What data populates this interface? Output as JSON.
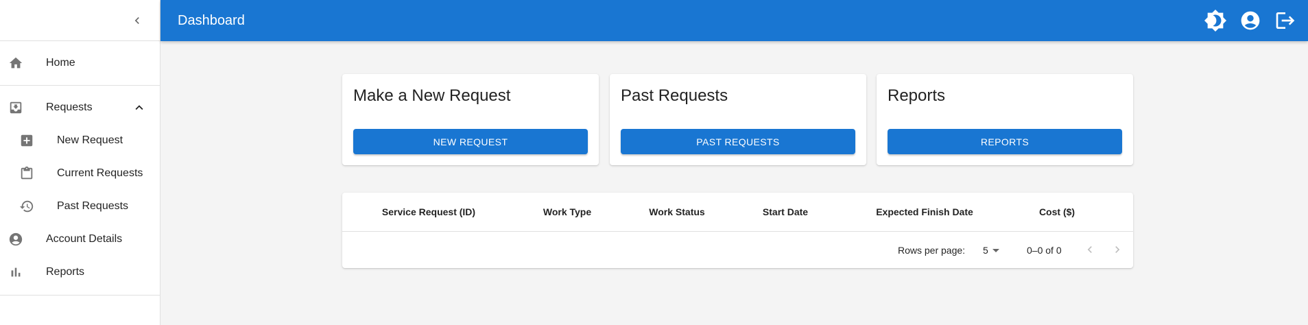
{
  "app_bar": {
    "title": "Dashboard",
    "actions": [
      {
        "icon": "brightness-icon",
        "name": "theme-toggle-button"
      },
      {
        "icon": "account-circle-icon",
        "name": "account-button"
      },
      {
        "icon": "logout-icon",
        "name": "logout-button"
      }
    ]
  },
  "sidebar": {
    "items": [
      {
        "label": "Home",
        "icon": "home-icon"
      },
      {
        "label": "Requests",
        "icon": "inbox-icon",
        "expanded": true
      },
      {
        "label": "New Request",
        "icon": "add-box-icon"
      },
      {
        "label": "Current Requests",
        "icon": "clipboard-icon"
      },
      {
        "label": "Past Requests",
        "icon": "history-icon"
      },
      {
        "label": "Account Details",
        "icon": "account-circle-icon"
      },
      {
        "label": "Reports",
        "icon": "bar-chart-icon"
      }
    ]
  },
  "cards": [
    {
      "title": "Make a New Request",
      "button": "NEW REQUEST"
    },
    {
      "title": "Past Requests",
      "button": "PAST REQUESTS"
    },
    {
      "title": "Reports",
      "button": "REPORTS"
    }
  ],
  "table": {
    "columns": [
      "Service Request (ID)",
      "Work Type",
      "Work Status",
      "Start Date",
      "Expected Finish Date",
      "Cost ($)"
    ],
    "rows": [],
    "pagination": {
      "rows_per_page_label": "Rows per page:",
      "rows_per_page": "5",
      "range": "0–0 of 0"
    }
  },
  "colors": {
    "primary": "#1976d2",
    "background": "#f4f4f4"
  }
}
